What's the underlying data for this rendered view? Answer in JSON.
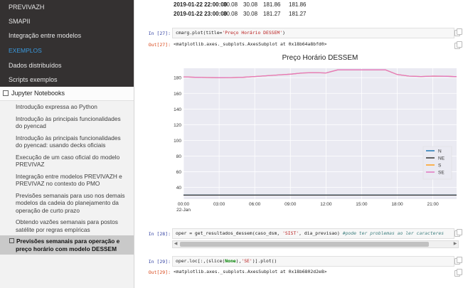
{
  "sidebar": {
    "top_items": [
      "PREVIVAZH",
      "SMAPII",
      "Integração entre modelos"
    ],
    "caption": "EXEMPLOS",
    "example_items": [
      "Dados distribuídos",
      "Scripts exemplos"
    ],
    "notebooks_label": "Jupyter Notebooks",
    "notebooks": [
      "Introdução expressa ao Python",
      "Introdução às principais funcionalidades do pyencad",
      "Introdução às principais funcionalidades do pyencad: usando decks oficiais",
      "Execução de um caso oficial do modelo PREVIVAZ",
      "Integração entre modelos PREVIVAZH e PREVIVAZ no contexto do PMO",
      "Previsões semanais para uso nos demais modelos da cadeia do planejamento da operação de curto prazo",
      "Obtendo vazões semanais para postos satélite por regras empíricas",
      "Previsões semanais para operação e preço horário com modelo DESSEM"
    ],
    "active_notebook_index": 7
  },
  "table": {
    "rows": [
      [
        "2019-01-22 22:00:00",
        "30.08",
        "30.08",
        "181.86",
        "181.86"
      ],
      [
        "2019-01-22 23:00:00",
        "30.08",
        "30.08",
        "181.27",
        "181.27"
      ]
    ]
  },
  "cells": {
    "c27_in_prompt": "In [27]:",
    "c27_code_a": "cmarg.plot(title=",
    "c27_code_str": "'Preço Horário DESSEM'",
    "c27_code_b": ")",
    "c27_out_prompt": "Out[27]:",
    "c27_out_text": "<matplotlib.axes._subplots.AxesSubplot at 0x18b64a8bfd0>",
    "c28_in_prompt": "In [28]:",
    "c28_code_a": "oper = get_resultados_dessem(caso_dsm, ",
    "c28_code_str1": "'SIST'",
    "c28_code_b": ", dia_previsao) ",
    "c28_code_comment": "#pode ter problemas ao ler caracteres",
    "c29_in_prompt": "In [29]:",
    "c29_code_a": "oper.loc[:,(slice(",
    "c29_code_kw": "None",
    "c29_code_b": "),",
    "c29_code_str": "'SE'",
    "c29_code_c": ")].plot()",
    "c29_out_prompt": "Out[29]:",
    "c29_out_text": "<matplotlib.axes._subplots.AxesSubplot at 0x18b6802d2e8>"
  },
  "chart_data": {
    "type": "line",
    "title": "Preço Horário DESSEM",
    "x": [
      0,
      1,
      2,
      3,
      4,
      5,
      6,
      7,
      8,
      9,
      10,
      11,
      12,
      13,
      14,
      15,
      16,
      17,
      18,
      19,
      20,
      21,
      22,
      23
    ],
    "xticks": [
      {
        "x": 0,
        "label": "00:00",
        "sublabel": "22-Jan"
      },
      {
        "x": 3,
        "label": "03:00"
      },
      {
        "x": 6,
        "label": "06:00"
      },
      {
        "x": 9,
        "label": "09:00"
      },
      {
        "x": 12,
        "label": "12:00"
      },
      {
        "x": 15,
        "label": "15:00"
      },
      {
        "x": 18,
        "label": "18:00"
      },
      {
        "x": 21,
        "label": "21:00"
      }
    ],
    "xlim": [
      0,
      23
    ],
    "ylim": [
      25,
      192
    ],
    "yticks": [
      40,
      60,
      80,
      100,
      120,
      140,
      160,
      180
    ],
    "grid": true,
    "legend": "right",
    "series": [
      {
        "name": "N",
        "color": "#1f77b4",
        "values": [
          30.08,
          30.08,
          30.08,
          30.08,
          30.08,
          30.08,
          30.08,
          30.08,
          30.08,
          30.08,
          30.08,
          30.08,
          30.08,
          30.08,
          30.08,
          30.08,
          30.08,
          30.08,
          30.08,
          30.08,
          30.08,
          30.08,
          30.08,
          30.08
        ]
      },
      {
        "name": "NE",
        "color": "#333333",
        "values": [
          30.08,
          30.08,
          30.08,
          30.08,
          30.08,
          30.08,
          30.08,
          30.08,
          30.08,
          30.08,
          30.08,
          30.08,
          30.08,
          30.08,
          30.08,
          30.08,
          30.08,
          30.08,
          30.08,
          30.08,
          30.08,
          30.08,
          30.08,
          30.08
        ]
      },
      {
        "name": "S",
        "color": "#ff9f1c",
        "values": [
          181.0,
          180.5,
          180.2,
          180.0,
          180.1,
          180.5,
          181.5,
          182.5,
          183.5,
          184.5,
          186.0,
          186.5,
          186.0,
          190.0,
          190.0,
          190.0,
          190.0,
          190.0,
          184.0,
          182.0,
          181.5,
          182.0,
          181.9,
          181.3
        ]
      },
      {
        "name": "SE",
        "color": "#e377c2",
        "values": [
          181.0,
          180.5,
          180.2,
          180.0,
          180.1,
          180.5,
          181.5,
          182.5,
          183.5,
          184.5,
          186.0,
          186.5,
          186.0,
          190.0,
          190.0,
          190.0,
          190.0,
          190.0,
          184.0,
          182.0,
          181.5,
          182.0,
          181.86,
          181.27
        ]
      }
    ]
  }
}
